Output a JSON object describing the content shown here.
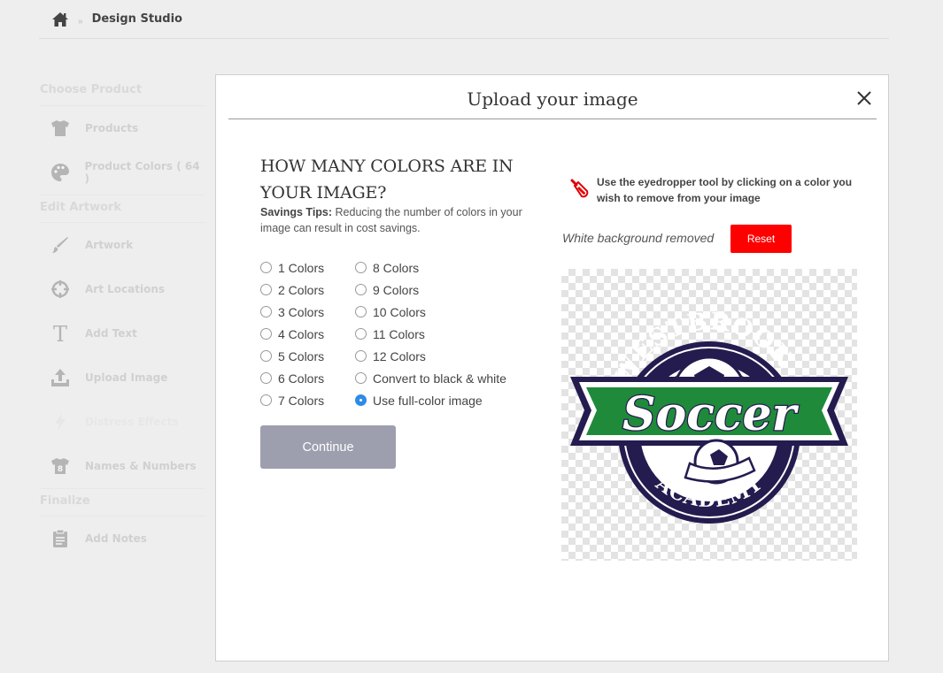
{
  "breadcrumb": {
    "current": "Design Studio",
    "separator": "»"
  },
  "sidebar": {
    "sections": [
      {
        "title": "Choose Product"
      },
      {
        "title": "Edit Artwork"
      },
      {
        "title": "Finalize"
      }
    ],
    "items": {
      "products": "Products",
      "product_colors": "Product Colors",
      "product_colors_count": "( 64 )",
      "artwork": "Artwork",
      "art_locations": "Art Locations",
      "add_text": "Add Text",
      "upload_image": "Upload Image",
      "distress_effects": "Distress Effects",
      "names_numbers": "Names & Numbers",
      "add_notes": "Add Notes"
    }
  },
  "modal": {
    "title": "Upload your image",
    "heading": "HOW MANY COLORS ARE IN YOUR IMAGE?",
    "tips_label": "Savings Tips:",
    "tips_text": " Reducing the number of colors in your image can result in cost savings.",
    "options_col1": [
      "1 Colors",
      "2 Colors",
      "3 Colors",
      "4 Colors",
      "5 Colors",
      "6 Colors",
      "7 Colors"
    ],
    "options_col2": [
      "8 Colors",
      "9 Colors",
      "10 Colors",
      "11 Colors",
      "12 Colors",
      "Convert to black & white",
      "Use full-color image"
    ],
    "selected_option": "Use full-color image",
    "continue_label": "Continue",
    "eyedropper_text": "Use the eyedropper tool by clicking on a color you wish to remove from your image",
    "bg_removed_text": "White background removed",
    "reset_label": "Reset",
    "logo": {
      "top_text": "WESTBROOKE",
      "center_text": "Soccer",
      "bottom_text": "ACADEMY",
      "navy": "#241c4f",
      "green": "#1f8a3a"
    }
  },
  "colors": {
    "accent_blue": "#2f8be6",
    "reset_red": "#ff0000",
    "continue_gray": "#9e9fae"
  }
}
